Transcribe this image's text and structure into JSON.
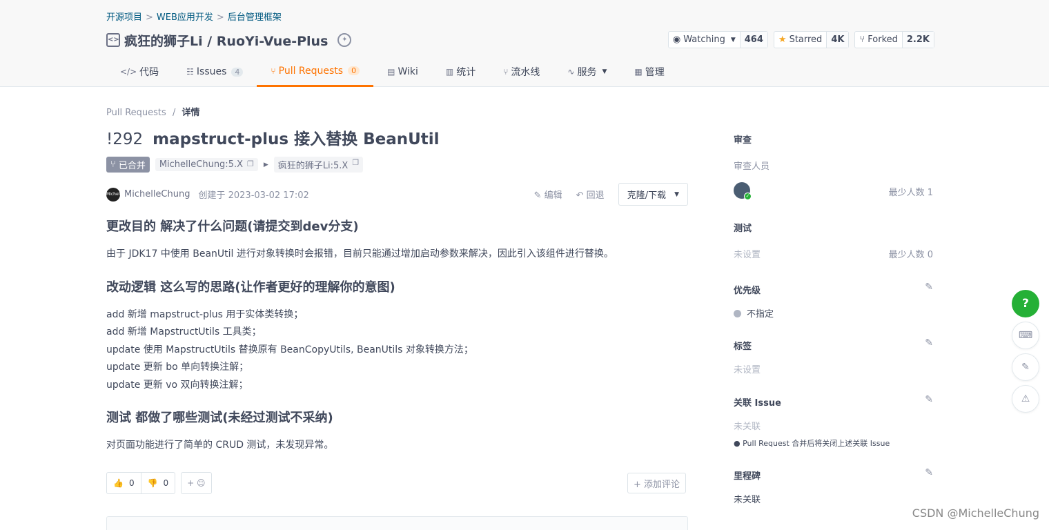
{
  "breadcrumb": [
    "开源项目",
    "WEB应用开发",
    "后台管理框架"
  ],
  "breadcrumb_sep": ">",
  "repo": {
    "icon": "code-repo-icon",
    "name": "疯狂的狮子Li / RuoYi-Vue-Plus",
    "award_icon": "award-icon"
  },
  "repo_buttons": {
    "watching": {
      "label": "Watching",
      "count": "464"
    },
    "starred": {
      "label": "Starred",
      "count": "4K"
    },
    "forked": {
      "label": "Forked",
      "count": "2.2K"
    }
  },
  "tabs": [
    {
      "label": "代码",
      "icon": "</>"
    },
    {
      "label": "Issues",
      "badge": "4",
      "icon": "☷"
    },
    {
      "label": "Pull Requests",
      "badge": "0",
      "icon": "⑂",
      "active": true
    },
    {
      "label": "Wiki",
      "icon": "▤"
    },
    {
      "label": "统计",
      "icon": "▥"
    },
    {
      "label": "流水线",
      "icon": "⑂"
    },
    {
      "label": "服务",
      "icon": "∿"
    },
    {
      "label": "管理",
      "icon": "▦"
    }
  ],
  "page_breadcrumb": {
    "root": "Pull Requests",
    "sep": "/",
    "current": "详情"
  },
  "pr": {
    "number": "!292",
    "title": "mapstruct-plus 接入替换 BeanUtil",
    "status": "已合并",
    "source_branch": "MichelleChung:5.X",
    "target_branch": "疯狂的狮子Li:5.X",
    "author": "MichelleChung",
    "avatar_text": "Michelle",
    "created": "创建于 2023-03-02 17:02",
    "edit_label": "编辑",
    "revert_label": "回退",
    "clone_label": "克隆/下载"
  },
  "body": {
    "h1": "更改目的 解决了什么问题(请提交到dev分支)",
    "p1": "由于 JDK17 中使用 BeanUtil 进行对象转换时会报错，目前只能通过增加启动参数来解决，因此引入该组件进行替换。",
    "h2": "改动逻辑 这么写的思路(让作者更好的理解你的意图)",
    "changes": [
      "add 新增 mapstruct-plus 用于实体类转换；",
      "add 新增 MapstructUtils 工具类；",
      "update 使用 MapstructUtils 替换原有 BeanCopyUtils, BeanUtils 对象转换方法；",
      "update 更新 bo 单向转换注解；",
      "update 更新 vo 双向转换注解；"
    ],
    "h3": "测试 都做了哪些测试(未经过测试不采纳)",
    "p3": "对页面功能进行了简单的 CRUD 测试，未发现异常。"
  },
  "reactions": {
    "thumbs_up": "0",
    "thumbs_down": "0",
    "add_emoji": "+ ☺",
    "add_comment": "+ 添加评论"
  },
  "sidebar": {
    "review_title": "审查",
    "reviewers_label": "审查人员",
    "review_min": "最少人数 1",
    "test_title": "测试",
    "test_value": "未设置",
    "test_min": "最少人数 0",
    "priority_title": "优先级",
    "priority_value": "不指定",
    "labels_title": "标签",
    "labels_value": "未设置",
    "issue_title": "关联 Issue",
    "issue_value": "未关联",
    "issue_note": "Pull Request 合并后将关闭上述关联 Issue",
    "milestone_title": "里程碑",
    "milestone_value": "未关联"
  },
  "floating": {
    "help": "?"
  },
  "watermark": "CSDN @MichelleChung",
  "colors": {
    "accent": "#fe7300",
    "link": "#005980",
    "merged": "#8c92a4",
    "help": "#25b036"
  }
}
